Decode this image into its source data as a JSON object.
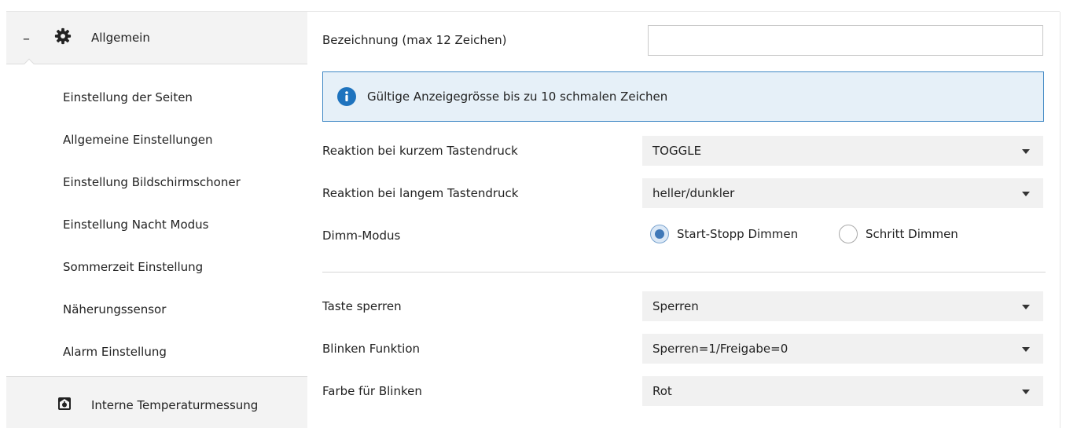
{
  "sidebar": {
    "header": {
      "collapse_symbol": "–",
      "icon": "gear-icon",
      "title": "Allgemein"
    },
    "items": [
      "Einstellung der Seiten",
      "Allgemeine Einstellungen",
      "Einstellung Bildschirmschoner",
      "Einstellung Nacht Modus",
      "Sommerzeit Einstellung",
      "Näherungssensor",
      "Alarm Einstellung"
    ],
    "footer": {
      "icon": "thermometer-device-icon",
      "label": "Interne Temperaturmessung"
    }
  },
  "main": {
    "name_label": "Bezeichnung (max 12 Zeichen)",
    "name_value": "",
    "info": {
      "icon": "info-icon",
      "text": "Gültige Anzeigegrösse bis zu 10 schmalen Zeichen"
    },
    "short_press": {
      "label": "Reaktion bei kurzem Tastendruck",
      "value": "TOGGLE"
    },
    "long_press": {
      "label": "Reaktion bei langem Tastendruck",
      "value": "heller/dunkler"
    },
    "dim_mode": {
      "label": "Dimm-Modus",
      "options": [
        "Start-Stopp Dimmen",
        "Schritt Dimmen"
      ],
      "selected": "Start-Stopp Dimmen"
    },
    "lock_key": {
      "label": "Taste sperren",
      "value": "Sperren"
    },
    "blink_function": {
      "label": "Blinken Funktion",
      "value": "Sperren=1/Freigabe=0"
    },
    "blink_color": {
      "label": "Farbe für Blinken",
      "value": "Rot"
    }
  },
  "colors": {
    "accent": "#1e73be",
    "info_bg": "#e6f0f8",
    "info_border": "#3f87c4",
    "select_bg": "#f1f1f1",
    "sidebar_bg": "#f3f3f3"
  }
}
